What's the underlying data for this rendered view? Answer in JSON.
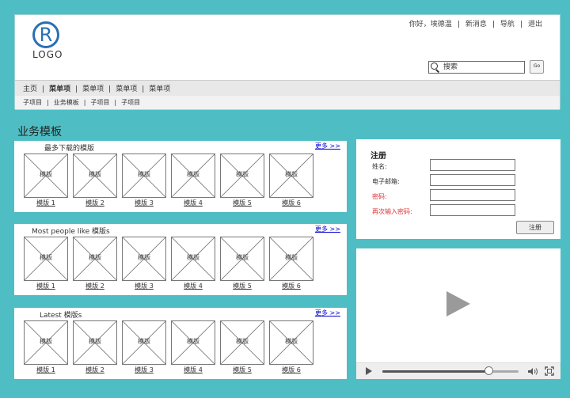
{
  "header": {
    "logo_mark": "R",
    "logo_text": "LOGO",
    "top_links": [
      "你好，埃德温",
      "新消息",
      "导航",
      "退出"
    ],
    "search": {
      "value": "搜索",
      "go_label": "Go"
    },
    "nav_items": [
      "主页",
      "菜单项",
      "菜单项",
      "菜单项",
      "菜单项"
    ],
    "subnav_items": [
      "子项目",
      "业务模板",
      "子项目",
      "子项目"
    ]
  },
  "section_title": "业务模板",
  "panels": [
    {
      "title": "最多下载的模版",
      "more": "更多 >>",
      "items": [
        {
          "thumb": "模版",
          "caption": "模版 1"
        },
        {
          "thumb": "模版",
          "caption": "模版 2"
        },
        {
          "thumb": "模版",
          "caption": "模版 3"
        },
        {
          "thumb": "模版",
          "caption": "模版 4"
        },
        {
          "thumb": "模版",
          "caption": "模版 5"
        },
        {
          "thumb": "模版",
          "caption": "模版 6"
        }
      ]
    },
    {
      "title": "Most people like 模版s",
      "more": "更多 >>",
      "items": [
        {
          "thumb": "模版",
          "caption": "模版 1"
        },
        {
          "thumb": "模版",
          "caption": "模版 2"
        },
        {
          "thumb": "模版",
          "caption": "模版 3"
        },
        {
          "thumb": "模版",
          "caption": "模版 4"
        },
        {
          "thumb": "模版",
          "caption": "模版 5"
        },
        {
          "thumb": "模版",
          "caption": "模版 6"
        }
      ]
    },
    {
      "title": "Latest 模版s",
      "more": "更多 >>",
      "items": [
        {
          "thumb": "模版",
          "caption": "模版 1"
        },
        {
          "thumb": "模版",
          "caption": "模版 2"
        },
        {
          "thumb": "模版",
          "caption": "模版 3"
        },
        {
          "thumb": "模版",
          "caption": "模版 4"
        },
        {
          "thumb": "模版",
          "caption": "模版 5"
        },
        {
          "thumb": "模版",
          "caption": "模版 6"
        }
      ]
    }
  ],
  "register": {
    "title": "注册",
    "fields": [
      {
        "label": "姓名:",
        "required": false
      },
      {
        "label": "电子邮箱:",
        "required": false
      },
      {
        "label": "密码:",
        "required": true
      },
      {
        "label": "再次输入密码:",
        "required": true
      }
    ],
    "submit_label": "注册"
  },
  "video": {
    "progress": 0.78,
    "icons": {
      "play": "play-icon",
      "pause": "play-icon",
      "volume": "volume-icon",
      "fullscreen": "fullscreen-icon"
    }
  },
  "colors": {
    "background": "#4fbec4",
    "logo_blue": "#2a6fb5",
    "link_blue": "#0000cc",
    "required_red": "#d33333"
  }
}
